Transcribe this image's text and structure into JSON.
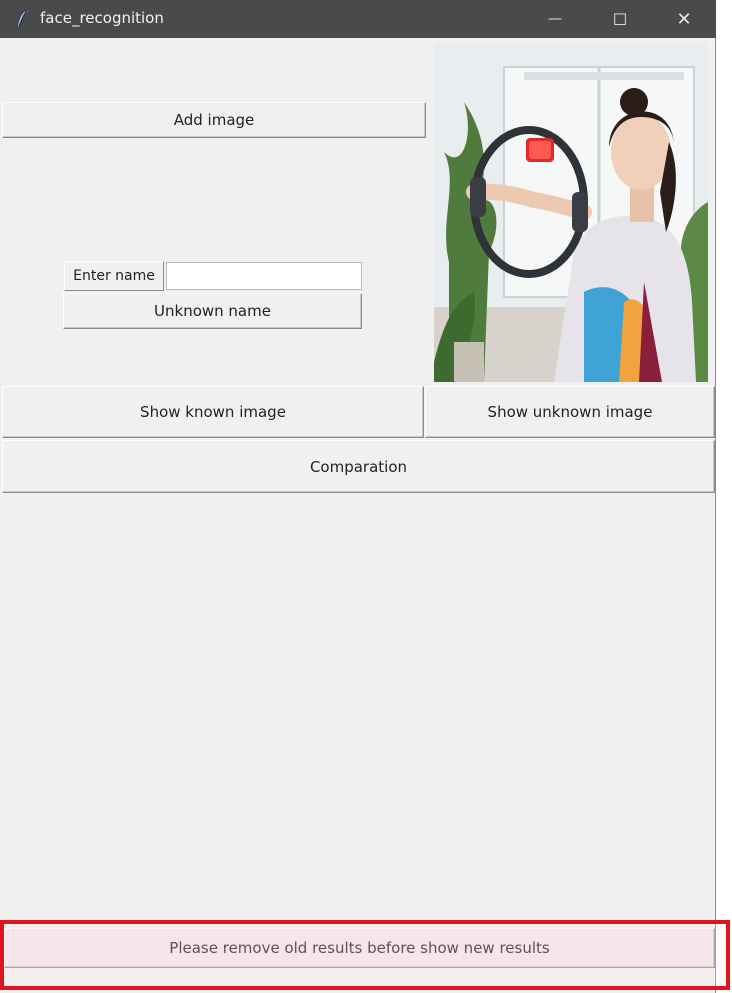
{
  "window": {
    "title": "face_recognition"
  },
  "controls": {
    "minimize": "—",
    "maximize": "☐",
    "close": "✕"
  },
  "buttons": {
    "add_image": "Add image",
    "enter_name": "Enter name",
    "unknown_name": "Unknown name",
    "show_known_image": "Show known image",
    "show_unknown_image": "Show unknown image",
    "comparation": "Comparation",
    "remove_old_results": "Please remove old results before show new results"
  },
  "inputs": {
    "name_value": ""
  },
  "colors": {
    "titlebar": "#4a4a4a",
    "window_bg": "#f0f0f0",
    "highlight_border": "#e0141e"
  },
  "icons": [
    "tk-feather-icon",
    "minimize-icon",
    "maximize-icon",
    "close-icon"
  ]
}
